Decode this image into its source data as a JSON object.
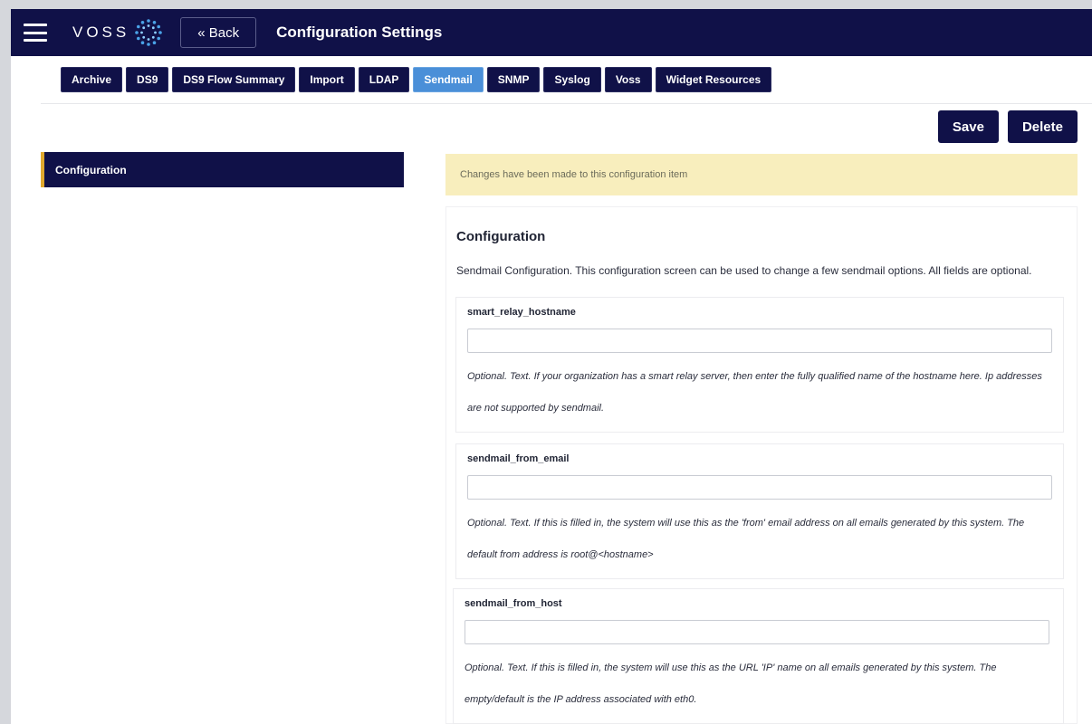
{
  "header": {
    "logo_text": "VOSS",
    "back_label": "« Back",
    "title": "Configuration Settings"
  },
  "tabs": [
    {
      "label": "Archive",
      "active": false
    },
    {
      "label": "DS9",
      "active": false
    },
    {
      "label": "DS9 Flow Summary",
      "active": false
    },
    {
      "label": "Import",
      "active": false
    },
    {
      "label": "LDAP",
      "active": false
    },
    {
      "label": "Sendmail",
      "active": true
    },
    {
      "label": "SNMP",
      "active": false
    },
    {
      "label": "Syslog",
      "active": false
    },
    {
      "label": "Voss",
      "active": false
    },
    {
      "label": "Widget Resources",
      "active": false
    }
  ],
  "actions": {
    "save_label": "Save",
    "delete_label": "Delete"
  },
  "sidebar": {
    "items": [
      {
        "label": "Configuration"
      }
    ]
  },
  "alert": {
    "text": "Changes have been made to this configuration item"
  },
  "config": {
    "title": "Configuration",
    "description": "Sendmail Configuration. This configuration screen can be used to change a few sendmail options. All fields are optional.",
    "fields": [
      {
        "label": "smart_relay_hostname",
        "value": "",
        "help": "Optional. Text. If your organization has a smart relay server, then enter the fully qualified name of the hostname here. Ip addresses are not supported by sendmail."
      },
      {
        "label": "sendmail_from_email",
        "value": "",
        "help": "Optional. Text. If this is filled in, the system will use this as the 'from' email address on all emails generated by this system. The default from address is root@<hostname>"
      },
      {
        "label": "sendmail_from_host",
        "value": "",
        "help": "Optional. Text. If this is filled in, the system will use this as the URL 'IP' name on all emails generated by this system. The empty/default is the IP address associated with eth0."
      }
    ]
  },
  "colors": {
    "navy": "#101148",
    "active_tab": "#4a8fd8",
    "alert_bg": "#f8eebd",
    "sidebar_accent": "#e0a82e"
  },
  "icons": {
    "menu": "hamburger-menu-icon",
    "logo": "voss-logo-icon"
  }
}
